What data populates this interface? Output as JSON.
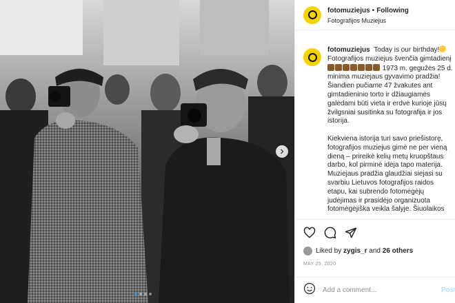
{
  "header": {
    "username": "fotomuziejus",
    "separator": "•",
    "follow_status": "Following",
    "subtitle": "Fotografijos Muziejus"
  },
  "caption": {
    "username": "fotomuziejus",
    "intro": "Today is our birthday!",
    "line2": "Fotografijos muziejus švenčia gimtadienį",
    "year": "1973 m.",
    "paragraph1_rest": "gegužės 25 d. minima muziejaus gyvavimo pradžia! Šiandien pučiame 47 žvakutes ant gimtadieninio torto ir džiaugiamės galėdami būti vieta ir erdvė kurioje jūsų žvilgsniai susitinka su fotografija ir jos istorija.",
    "paragraph2": "Kiekviena istorija turi savo priešistorę, fotografijos muziejus gimė ne per vieną dieną – prireikė kelių metų kruopštaus darbo, kol pirminė idėja tapo materija. Muziejaus pradžia glaudžiai siejasi su svarbiu Lietuvos fotografijos raidos etapu, kai subrendo fotomėgėjų judėjimas ir prasidėjo organizuota fotomėgėjiška veikla šalyje. Šiuolaikos"
  },
  "actions": {
    "like_icon": "heart-icon",
    "comment_icon": "comment-icon",
    "share_icon": "paper-plane-icon"
  },
  "likes": {
    "prefix": "Liked by",
    "user": "zygis_r",
    "conj": "and",
    "others": "26 others"
  },
  "date": "MAY 25, 2020",
  "comment": {
    "placeholder": "Add a comment...",
    "post_label": "Post"
  },
  "carousel": {
    "slides_shown": 4,
    "active_index": 0
  }
}
